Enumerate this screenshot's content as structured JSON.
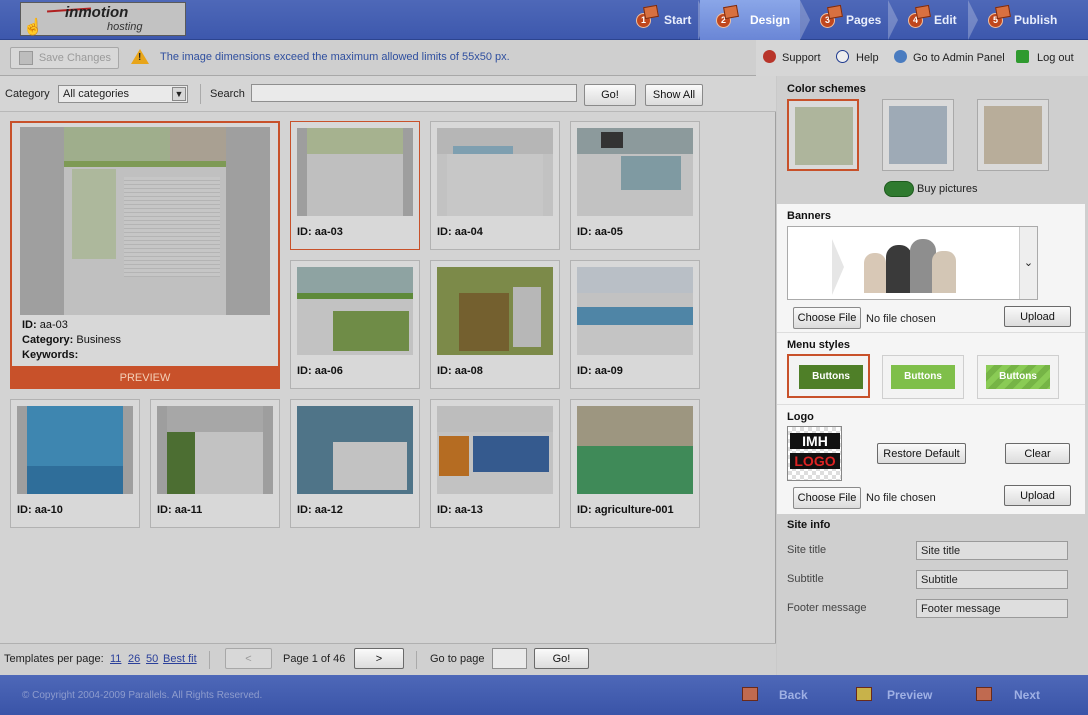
{
  "header": {
    "logo_text": "inmotion",
    "logo_sub": "hosting",
    "steps": [
      {
        "num": "1",
        "label": "Start"
      },
      {
        "num": "2",
        "label": "Design"
      },
      {
        "num": "3",
        "label": "Pages"
      },
      {
        "num": "4",
        "label": "Edit"
      },
      {
        "num": "5",
        "label": "Publish"
      }
    ]
  },
  "toolbar": {
    "save_label": "Save Changes",
    "warning": "The image dimensions exceed the maximum allowed limits of 55x50 px.",
    "support": "Support",
    "help": "Help",
    "admin": "Go to Admin Panel",
    "logout": "Log out"
  },
  "filter": {
    "category_label": "Category",
    "category_value": "All categories",
    "search_label": "Search",
    "search_value": "",
    "go_label": "Go!",
    "show_all_label": "Show All"
  },
  "big_card": {
    "id_label": "ID:",
    "id": "aa-03",
    "category_label": "Category:",
    "category": "Business",
    "keywords_label": "Keywords:",
    "preview_label": "PREVIEW"
  },
  "templates": [
    {
      "id": "ID: aa-03"
    },
    {
      "id": "ID: aa-04"
    },
    {
      "id": "ID: aa-05"
    },
    {
      "id": "ID: aa-06"
    },
    {
      "id": "ID: aa-08"
    },
    {
      "id": "ID: aa-09"
    },
    {
      "id": "ID: aa-10"
    },
    {
      "id": "ID: aa-11"
    },
    {
      "id": "ID: aa-12"
    },
    {
      "id": "ID: aa-13"
    },
    {
      "id": "ID: agriculture-001"
    }
  ],
  "right": {
    "color_schemes_title": "Color schemes",
    "buy_pictures": "Buy pictures",
    "banners_title": "Banners",
    "choose_file": "Choose File",
    "no_file": "No file chosen",
    "upload": "Upload",
    "menu_styles_title": "Menu styles",
    "menu_button_label": "Buttons",
    "logo_title": "Logo",
    "logo_line1": "IMH",
    "logo_line2": "LOGO",
    "restore_default": "Restore Default",
    "clear": "Clear",
    "site_info_title": "Site info",
    "site_title_label": "Site title",
    "site_title_value": "Site title",
    "subtitle_label": "Subtitle",
    "subtitle_value": "Subtitle",
    "footer_label": "Footer message",
    "footer_value": "Footer message"
  },
  "pager": {
    "per_page_label": "Templates per page:",
    "opt1": "11",
    "opt2": "26",
    "opt3": "50",
    "best_fit": "Best fit",
    "prev": "<",
    "page_text": "Page 1 of 46",
    "next": ">",
    "goto_label": "Go to page",
    "goto_value": "",
    "go_label": "Go!"
  },
  "footer": {
    "copyright": "© Copyright 2004-2009 Parallels. All Rights Reserved.",
    "back": "Back",
    "preview": "Preview",
    "next": "Next"
  },
  "colors": {
    "header": "#3d58ad",
    "accent": "#c8512a",
    "link": "#2a3f9a"
  }
}
